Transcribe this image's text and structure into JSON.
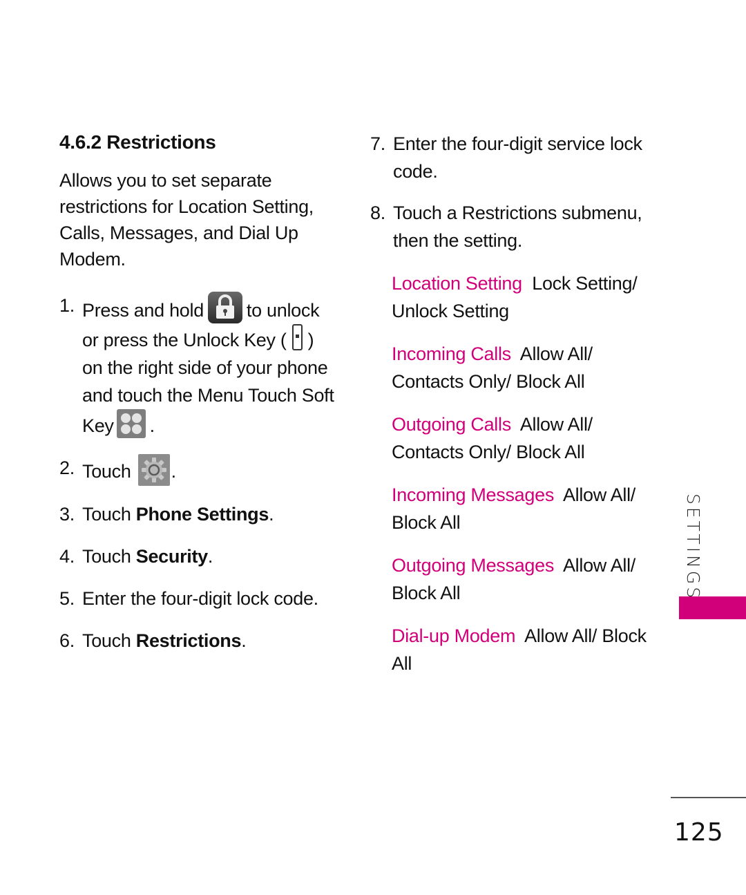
{
  "colors": {
    "accent": "#d1007a",
    "text": "#111111"
  },
  "section": {
    "title": "4.6.2 Restrictions",
    "intro": "Allows you to set separate restrictions for Location Setting, Calls, Messages, and Dial Up Modem."
  },
  "steps": [
    {
      "number": "1.",
      "part1": "Press and hold",
      "icon1": "lock-icon",
      "part2": "to unlock or press the Unlock Key (",
      "icon2": "unlock-key-icon",
      "part3": ") on the right side of your phone and touch the Menu Touch Soft Key",
      "icon3": "menu-grid-icon",
      "part4": "."
    },
    {
      "number": "2.",
      "part1": "Touch",
      "icon1": "gear-icon",
      "part2": "."
    },
    {
      "number": "3.",
      "prefix": "Touch ",
      "bold": "Phone Settings",
      "suffix": "."
    },
    {
      "number": "4.",
      "prefix": "Touch ",
      "bold": "Security",
      "suffix": "."
    },
    {
      "number": "5.",
      "text": "Enter the four-digit lock code."
    },
    {
      "number": "6.",
      "prefix": "Touch ",
      "bold": "Restrictions",
      "suffix": "."
    },
    {
      "number": "7.",
      "text": "Enter the four-digit service lock code."
    },
    {
      "number": "8.",
      "text": "Touch a Restrictions submenu, then the setting."
    }
  ],
  "options": [
    {
      "label": "Location Setting",
      "values": "Lock Setting/ Unlock Setting"
    },
    {
      "label": "Incoming Calls",
      "values": "Allow All/ Contacts Only/ Block All"
    },
    {
      "label": "Outgoing Calls",
      "values": "Allow All/ Contacts Only/ Block All"
    },
    {
      "label": "Incoming Messages",
      "values": "Allow All/ Block All"
    },
    {
      "label": "Outgoing Messages",
      "values": "Allow All/ Block All"
    },
    {
      "label": "Dial-up Modem",
      "values": "Allow All/ Block All"
    }
  ],
  "side_tab": {
    "label": "SETTINGS",
    "color": "#d1007a"
  },
  "page_number": "125"
}
